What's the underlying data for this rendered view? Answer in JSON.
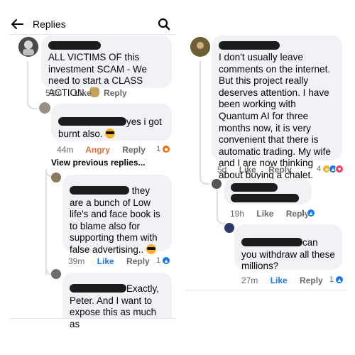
{
  "header": {
    "title": "Replies"
  },
  "left": {
    "c1": {
      "text": "ALL VICTIMS OF this investment SCAM - We need to start a CLASS ACTION.",
      "time": "53m",
      "like": "Like",
      "reply": "Reply"
    },
    "c2": {
      "text": "yes i got burnt also.",
      "time": "44m",
      "reaction": "Angry",
      "reply": "Reply",
      "count": "1"
    },
    "view_prev": "View previous replies...",
    "c3": {
      "text": "they are a bunch of Low life's and face book is to blame also for supporting them with false advertising..",
      "time": "39m",
      "like": "Like",
      "reply": "Reply",
      "count": "1"
    },
    "c4": {
      "text_a": "Exactly,",
      "text_b": "Peter. And I want to expose this as much as"
    }
  },
  "right": {
    "c1": {
      "text": "I don't usually leave comments on the internet. But this project really deserves attention. I have been working with Quantum AI for three months now, it is very convenient that there is automatic trading. My wife and I are now thinking about buying a chalet.",
      "time": "5d",
      "like": "Like",
      "reply": "Reply",
      "count": "4"
    },
    "c2": {
      "time": "19h",
      "like": "Like",
      "reply": "Reply",
      "count": "1"
    },
    "c3": {
      "text_a": "can you",
      "text_b": "withdraw  all these millions?",
      "time": "27m",
      "like": "Like",
      "reply": "Reply",
      "count": "1"
    }
  },
  "colors": {
    "accent": "#1877f2",
    "angry": "#e0703d",
    "bubble": "#f0f2f5"
  }
}
